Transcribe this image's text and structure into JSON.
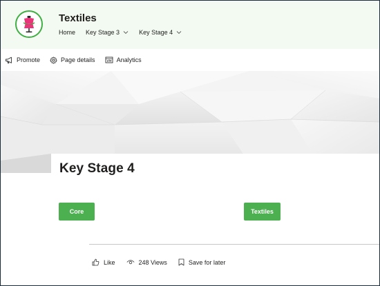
{
  "site": {
    "title": "Textiles",
    "nav": [
      {
        "label": "Home",
        "has_dropdown": false
      },
      {
        "label": "Key Stage 3",
        "has_dropdown": true
      },
      {
        "label": "Key Stage 4",
        "has_dropdown": true
      }
    ]
  },
  "command_bar": {
    "promote": "Promote",
    "page_details": "Page details",
    "analytics": "Analytics"
  },
  "page": {
    "title": "Key Stage 4",
    "buttons": {
      "core": "Core",
      "textiles": "Textiles"
    }
  },
  "footer": {
    "like": "Like",
    "views": "248 Views",
    "save": "Save for later"
  },
  "colors": {
    "header_bg": "#f3faf1",
    "accent_green": "#4caf50",
    "logo_ring": "#3fae43",
    "logo_figure": "#e8357a"
  },
  "icons": {
    "logo": "mannequin-icon",
    "promote": "megaphone-icon",
    "page_details": "gear-icon",
    "analytics": "analytics-icon",
    "like": "thumbs-up-icon",
    "views": "eye-icon",
    "save": "bookmark-icon",
    "dropdown": "chevron-down-icon"
  }
}
